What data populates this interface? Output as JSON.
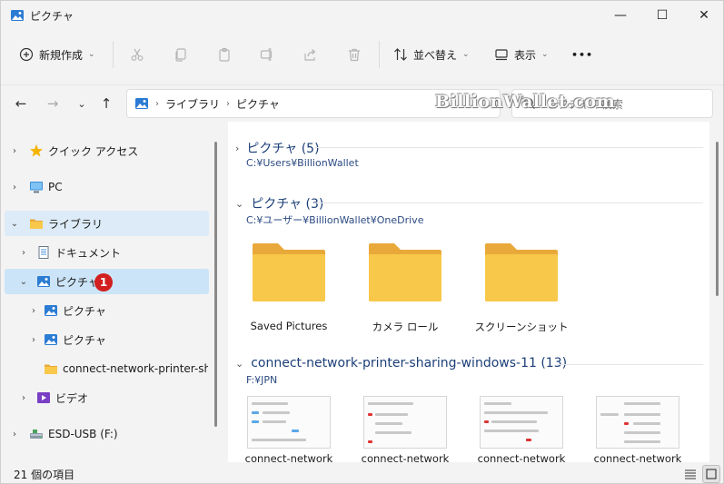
{
  "window": {
    "title": "ピクチャ"
  },
  "titlebar": {
    "minimize": "—",
    "maximize": "☐",
    "close": "✕"
  },
  "toolbar": {
    "new_label": "新規作成",
    "sort_label": "並べ替え",
    "view_label": "表示",
    "more_label": "•••"
  },
  "address": {
    "breadcrumb": [
      "ライブラリ",
      "ピクチャ"
    ],
    "search_placeholder": "ピクチャの検索",
    "watermark": "BillionWallet.com"
  },
  "nav": {
    "items": [
      {
        "label": "クイック アクセス"
      },
      {
        "label": "PC"
      },
      {
        "label": "ライブラリ"
      },
      {
        "label": "ドキュメント"
      },
      {
        "label": "ピクチャ"
      },
      {
        "label": "ピクチャ"
      },
      {
        "label": "ピクチャ"
      },
      {
        "label": "connect-network-printer-sharing"
      },
      {
        "label": "ビデオ"
      },
      {
        "label": "ESD-USB (F:)"
      }
    ],
    "badge": "1"
  },
  "groups": [
    {
      "title": "ピクチャ (5)",
      "path": "C:¥Users¥BillionWallet"
    },
    {
      "title": "ピクチャ (3)",
      "path": "C:¥ユーザー¥BillionWallet¥OneDrive",
      "folders": [
        "Saved Pictures",
        "カメラ ロール",
        "スクリーンショット"
      ]
    },
    {
      "title": "connect-network-printer-sharing-windows-11 (13)",
      "path": "F:¥JPN",
      "files": [
        "connect-network",
        "connect-network",
        "connect-network",
        "connect-network"
      ]
    }
  ],
  "status": {
    "count": "21 個の項目"
  },
  "colors": {
    "accent": "#0067c0",
    "selection": "#cce4f7",
    "folder": "#f8c84a",
    "badge": "#d21f1f"
  }
}
